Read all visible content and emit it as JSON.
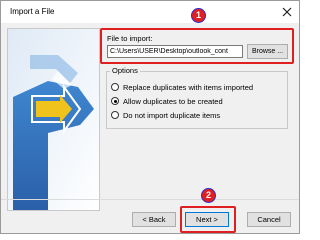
{
  "window": {
    "title": "Import a File",
    "close_icon": "close-icon"
  },
  "import": {
    "field_label": "File to import:",
    "path_value": "C:\\Users\\USER\\Desktop\\outlook_cont",
    "browse_label": "Browse ..."
  },
  "options": {
    "legend": "Options",
    "items": [
      {
        "label": "Replace duplicates with items imported",
        "checked": false
      },
      {
        "label": "Allow duplicates to be created",
        "checked": true
      },
      {
        "label": "Do not import duplicate items",
        "checked": false
      }
    ]
  },
  "buttons": {
    "back_label": "< Back",
    "next_label": "Next >",
    "cancel_label": "Cancel"
  },
  "annotations": {
    "badge_1": "1",
    "badge_2": "2",
    "highlight_color": "#e02020"
  }
}
